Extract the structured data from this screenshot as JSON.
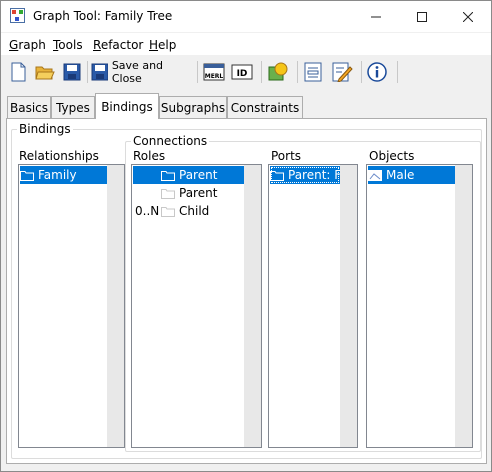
{
  "window": {
    "title": "Graph Tool: Family Tree"
  },
  "menu": {
    "graph": "raph",
    "graph_u": "G",
    "tools": "ools",
    "tools_u": "T",
    "refactor": "efactor",
    "refactor_u": "R",
    "help": "elp",
    "help_u": "H"
  },
  "toolbar": {
    "save_close_label": "Save and Close",
    "merl_label": "MERL",
    "id_label": "ID"
  },
  "tabs": [
    "Basics",
    "Types",
    "Bindings",
    "Subgraphs",
    "Constraints"
  ],
  "active_tab": "Bindings",
  "bindings": {
    "group_label": "Bindings",
    "relationships": {
      "label": "Relationships",
      "items": [
        "Family"
      ]
    },
    "connections": {
      "group_label": "Connections",
      "roles": {
        "label": "Roles",
        "items": [
          {
            "prefix": "",
            "text": "Parent"
          },
          {
            "prefix": "",
            "text": "Parent"
          },
          {
            "prefix": "0..N",
            "text": "Child"
          }
        ]
      },
      "ports": {
        "label": "Ports",
        "items": [
          "Parent: F..."
        ]
      },
      "objects": {
        "label": "Objects",
        "items": [
          "Male"
        ]
      }
    }
  },
  "colors": {
    "selection": "#0078d7",
    "folder_outline": "#4a6fa5"
  }
}
